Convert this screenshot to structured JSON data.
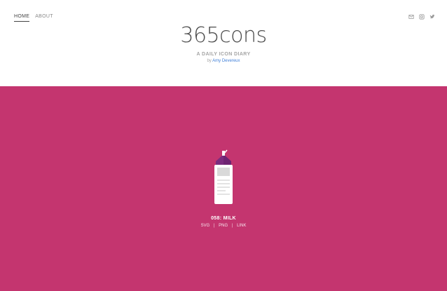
{
  "nav": {
    "items": [
      {
        "label": "HOME",
        "active": true
      },
      {
        "label": "ABOUT",
        "active": false
      }
    ]
  },
  "social": {
    "icons": [
      "mail-icon",
      "instagram-icon",
      "twitter-icon"
    ]
  },
  "site": {
    "title": "365cons",
    "tagline": "A DAILY ICON DIARY",
    "by_prefix": "by",
    "author": "Amy Devereux"
  },
  "hero": {
    "background": "#c4356f",
    "icon_name": "milk-carton-icon",
    "title": "058: MILK",
    "links": [
      "SVG",
      "PNG",
      "LINK"
    ]
  }
}
